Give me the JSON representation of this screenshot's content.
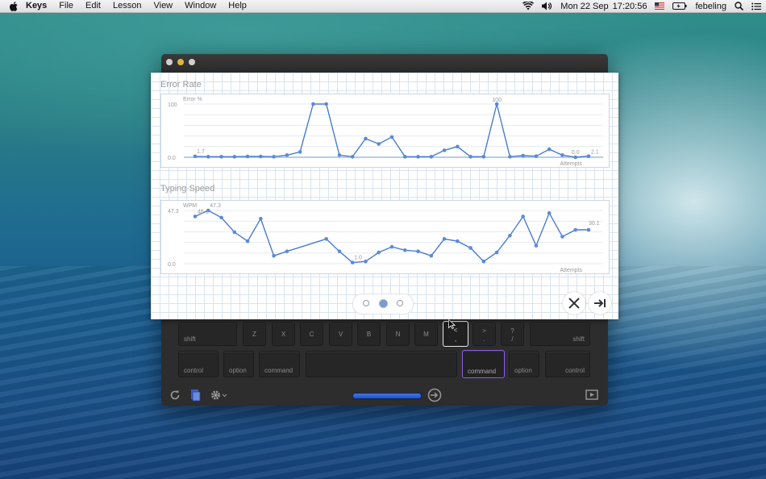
{
  "menubar": {
    "app_name": "Keys",
    "items": [
      "File",
      "Edit",
      "Lesson",
      "View",
      "Window",
      "Help"
    ],
    "date": "Mon 22 Sep",
    "time": "17:20:56",
    "user": "febeling",
    "icons": [
      "apple-icon",
      "wifi-icon",
      "volume-icon",
      "flag-icon",
      "battery-icon",
      "spotlight-icon",
      "notification-icon"
    ]
  },
  "stats": {
    "error_rate": {
      "title": "Error Rate",
      "y_label": "Error %",
      "y_top": "100",
      "y_bottom": "0.0",
      "x_label": "Attempts",
      "labels": {
        "first": "1.7",
        "peak": "100",
        "low": "0.0",
        "last": "2.1"
      }
    },
    "typing_speed": {
      "title": "Typing Speed",
      "y_label": "WPM",
      "y_top": "47.3",
      "y_bottom": "0.0",
      "x_label": "Attempts",
      "labels": {
        "first": "46.1",
        "peak": "47.3",
        "low": "1.0",
        "last": "30.1"
      }
    }
  },
  "chart_data": [
    {
      "type": "line",
      "title": "Error Rate",
      "ylabel": "Error %",
      "xlabel": "Attempts",
      "ylim": [
        0,
        100
      ],
      "grid": true,
      "series": [
        {
          "values": [
            1.7,
            1,
            1,
            1,
            1.5,
            1.5,
            1,
            4,
            10,
            100,
            100,
            4,
            1,
            35,
            25,
            38,
            1,
            1,
            1,
            13,
            20,
            1,
            1,
            100,
            1,
            3,
            2,
            15,
            4,
            0.0,
            2.1
          ]
        }
      ]
    },
    {
      "type": "line",
      "title": "Typing Speed",
      "ylabel": "WPM",
      "xlabel": "Attempts",
      "ylim": [
        0,
        47.3
      ],
      "grid": true,
      "series": [
        {
          "x": [
            1,
            2,
            3,
            4,
            5,
            6,
            7,
            8,
            11,
            12,
            13,
            14,
            15,
            16,
            17,
            18,
            19,
            20,
            21,
            22,
            23,
            24,
            25,
            26,
            27,
            28,
            29,
            30,
            31
          ],
          "values": [
            42,
            47.3,
            41,
            28,
            20,
            40,
            7,
            11,
            22,
            11,
            1.0,
            2,
            10,
            15,
            12,
            11,
            7,
            22,
            20,
            14,
            2,
            10,
            25,
            42,
            16,
            45,
            24,
            30.1,
            30.1
          ]
        }
      ]
    }
  ],
  "keyboard": {
    "row_shift": [
      "shift",
      "Z",
      "X",
      "C",
      "V",
      "B",
      "N",
      "M",
      "<|,",
      ">|.",
      "?|/",
      "shift"
    ],
    "row_bottom": [
      "control",
      "option",
      "command",
      "",
      "command",
      "option",
      "control"
    ]
  }
}
